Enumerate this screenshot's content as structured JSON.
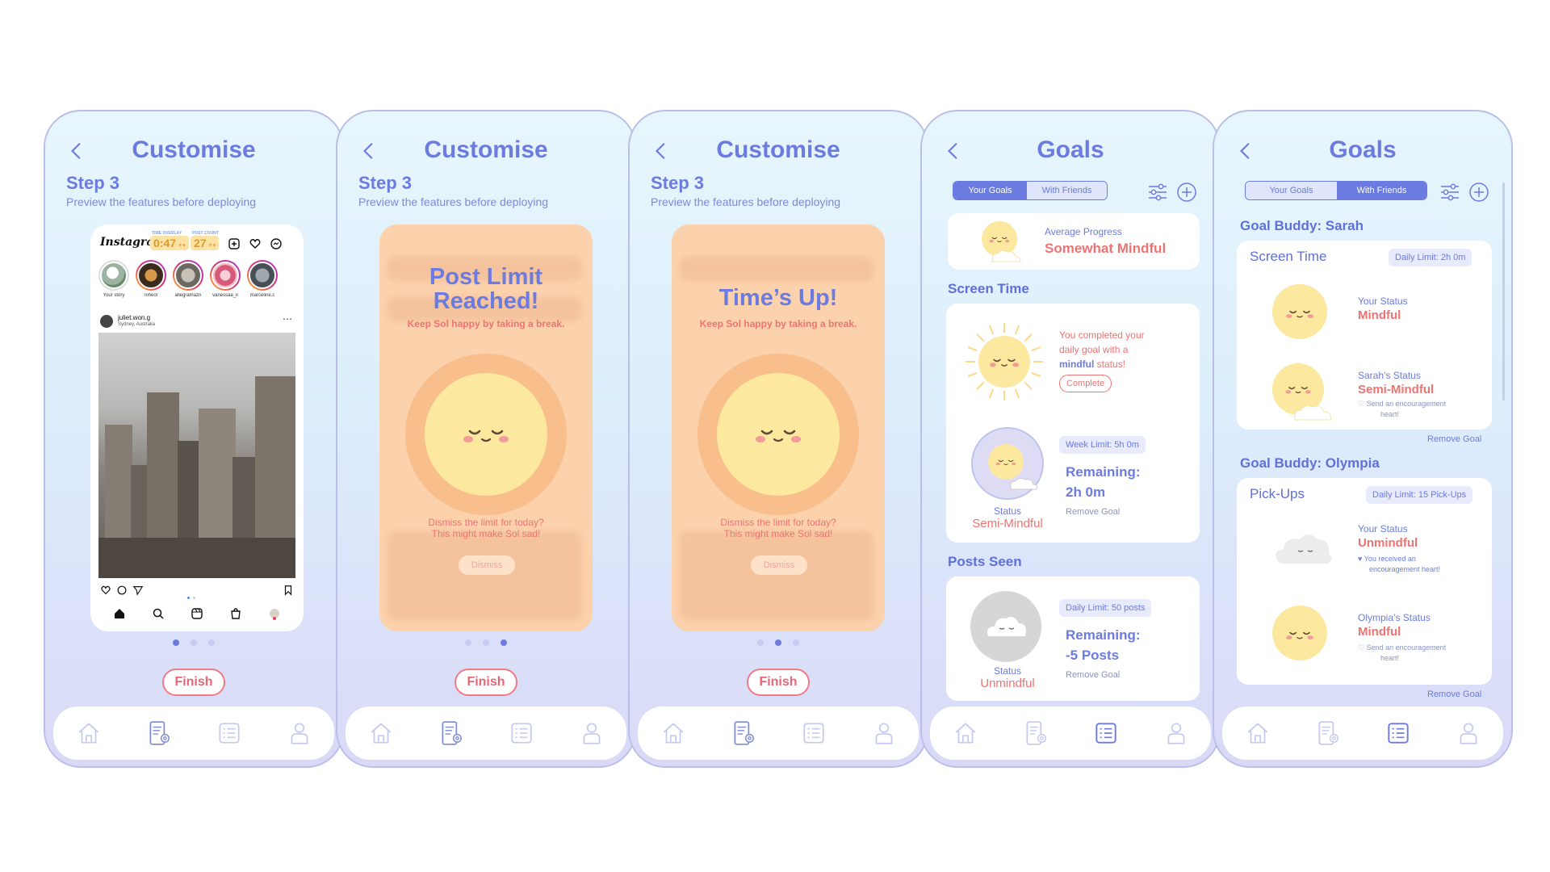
{
  "screens": [
    {
      "title": "Customise",
      "step": "Step 3",
      "subtitle": "Preview the features before deploying",
      "finish": "Finish",
      "instagram": {
        "logo": "Instagram",
        "overlay_label": "TIME OVERLAY",
        "count_label": "POST COUNT",
        "time": "0:47",
        "count": "27",
        "stories": [
          "Your story",
          "niheol",
          "allegramazn",
          "vanessaa_li",
          "marceline.c"
        ],
        "post_user": "juliet.won.g",
        "post_location": "Sydney, Australia"
      }
    },
    {
      "title": "Customise",
      "step": "Step 3",
      "subtitle": "Preview the features before deploying",
      "finish": "Finish",
      "popup_title": "Post Limit Reached!",
      "popup_msg": "Keep Sol happy by taking a break.",
      "dismiss_msg_1": "Dismiss the limit for today?",
      "dismiss_msg_2": "This might make Sol sad!",
      "dismiss": "Dismiss"
    },
    {
      "title": "Customise",
      "step": "Step 3",
      "subtitle": "Preview the features before deploying",
      "finish": "Finish",
      "popup_title": "Time’s Up!",
      "popup_msg": "Keep Sol happy by taking a break.",
      "dismiss_msg_1": "Dismiss the limit for today?",
      "dismiss_msg_2": "This might make Sol sad!",
      "dismiss": "Dismiss"
    },
    {
      "title": "Goals",
      "tabs": [
        "Your Goals",
        "With Friends"
      ],
      "avg_label": "Average Progress",
      "avg_value": "Somewhat Mindful",
      "screen_time": {
        "heading": "Screen Time",
        "msg_1": "You completed your",
        "msg_2": "daily goal with a",
        "msg_3a": "mindful",
        "msg_3b": " status!",
        "complete": "Complete",
        "limit": "Week Limit: 5h 0m",
        "remaining_label": "Remaining:",
        "remaining_value": "2h 0m",
        "remove": "Remove Goal",
        "status_label": "Status",
        "status_value": "Semi-Mindful"
      },
      "posts_seen": {
        "heading": "Posts Seen",
        "limit": "Daily Limit: 50 posts",
        "remaining_label": "Remaining:",
        "remaining_value": "-5 Posts",
        "remove": "Remove Goal",
        "status_label": "Status",
        "status_value": "Unmindful"
      }
    },
    {
      "title": "Goals",
      "tabs": [
        "Your Goals",
        "With Friends"
      ],
      "buddy1": {
        "heading": "Goal Buddy: Sarah",
        "category": "Screen Time",
        "limit": "Daily Limit: 2h 0m",
        "your_label": "Your Status",
        "your_value": "Mindful",
        "friend_label": "Sarah’s Status",
        "friend_value": "Semi-Mindful",
        "send_1": "Send an encouragement",
        "send_2": "heart!",
        "remove": "Remove Goal"
      },
      "buddy2": {
        "heading": "Goal Buddy: Olympia",
        "category": "Pick-Ups",
        "limit": "Daily Limit: 15 Pick-Ups",
        "your_label": "Your Status",
        "your_value": "Unmindful",
        "received_1": "You received an",
        "received_2": "encouragement heart!",
        "friend_label": "Olympia’s Status",
        "friend_value": "Mindful",
        "send_1": "Send an encouragement",
        "send_2": "heart!",
        "remove": "Remove Goal"
      }
    }
  ],
  "nav_icons": [
    "home-icon",
    "customise-phone-icon",
    "goals-list-icon",
    "profile-icon"
  ],
  "colors": {
    "primary": "#6b7be0",
    "accent": "#ee7373",
    "sun": "#fde8a0",
    "popup": "#fcd2ad"
  }
}
